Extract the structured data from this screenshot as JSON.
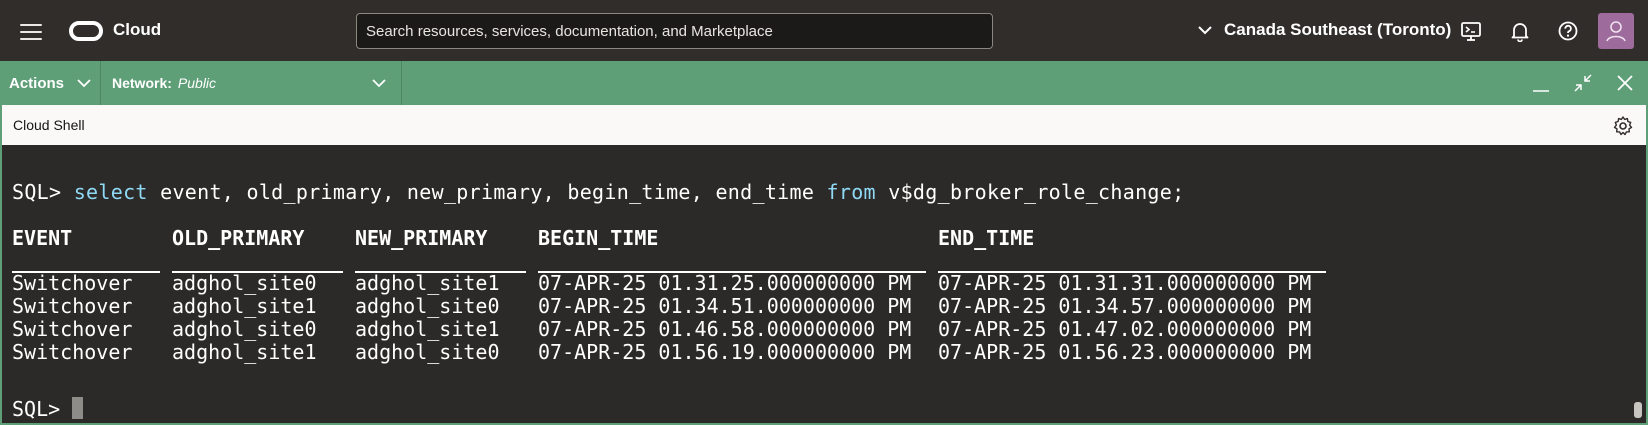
{
  "header": {
    "brand": "Cloud",
    "search_placeholder": "Search resources, services, documentation, and Marketplace",
    "region": "Canada Southeast (Toronto)"
  },
  "shell_bar": {
    "actions_label": "Actions",
    "network_label": "Network:",
    "network_value": "Public"
  },
  "shell": {
    "title": "Cloud Shell"
  },
  "terminal": {
    "prompt": "SQL>",
    "query_keyword_select": "select",
    "query_middle": " event, old_primary, new_primary, begin_time, end_time ",
    "query_keyword_from": "from",
    "query_tail": " v$dg_broker_role_change;",
    "columns": [
      "EVENT",
      "OLD_PRIMARY",
      "NEW_PRIMARY",
      "BEGIN_TIME",
      "END_TIME"
    ],
    "rows": [
      [
        "Switchover",
        "adghol_site0",
        "adghol_site1",
        "07-APR-25 01.31.25.000000000 PM",
        "07-APR-25 01.31.31.000000000 PM"
      ],
      [
        "Switchover",
        "adghol_site1",
        "adghol_site0",
        "07-APR-25 01.34.51.000000000 PM",
        "07-APR-25 01.34.57.000000000 PM"
      ],
      [
        "Switchover",
        "adghol_site0",
        "adghol_site1",
        "07-APR-25 01.46.58.000000000 PM",
        "07-APR-25 01.47.02.000000000 PM"
      ],
      [
        "Switchover",
        "adghol_site1",
        "adghol_site0",
        "07-APR-25 01.56.19.000000000 PM",
        "07-APR-25 01.56.23.000000000 PM"
      ]
    ],
    "final_prompt": "SQL>"
  },
  "colors": {
    "topbar": "#312d2a",
    "shell_green": "#5f9f78",
    "terminal_bg": "#2b2a28",
    "keyword": "#8fd9f5"
  },
  "icons": {
    "menu": "hamburger-icon",
    "logo": "oracle-logo",
    "region": "chevron-down-icon",
    "cloud_shell": "cloud-shell-icon",
    "notifications": "bell-icon",
    "help": "help-icon",
    "user": "user-avatar-icon",
    "minimize": "minimize-icon",
    "restore": "restore-icon",
    "close": "close-icon",
    "settings": "gear-icon"
  }
}
